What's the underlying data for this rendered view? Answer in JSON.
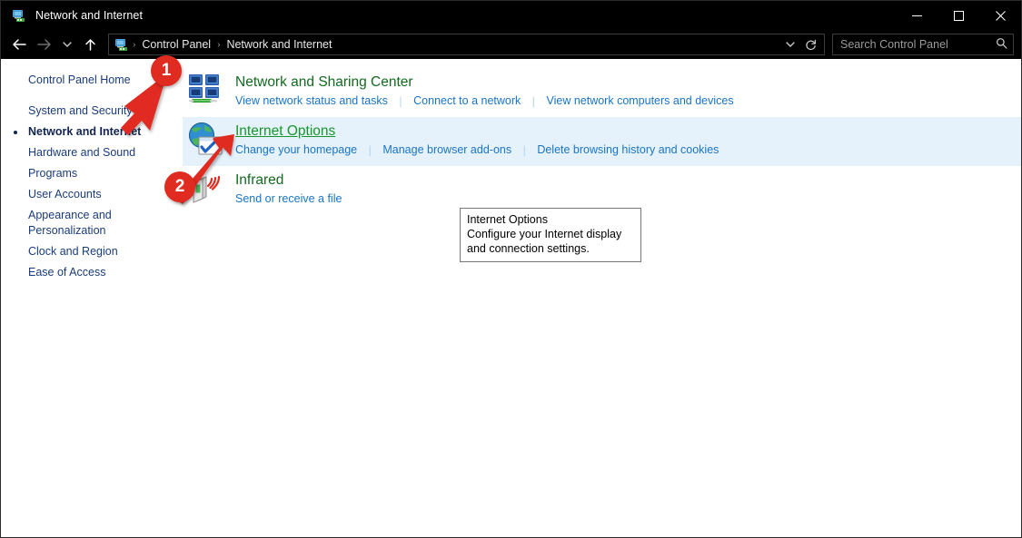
{
  "window": {
    "title": "Network and Internet",
    "icon": "network-folder-icon",
    "minimize_label": "—",
    "maximize_label": "❑",
    "close_label": "✕"
  },
  "addressbar": {
    "back_label": "←",
    "forward_label": "→",
    "recent_label": "⌄",
    "up_label": "↑",
    "path_icon": "network-folder-icon",
    "crumbs": [
      "Control Panel",
      "Network and Internet"
    ],
    "separator": "›",
    "dropdown_label": "⌄",
    "refresh_label": "↻"
  },
  "search": {
    "placeholder": "Search Control Panel",
    "value": "",
    "icon": "search-icon"
  },
  "sidebar": {
    "home": "Control Panel Home",
    "items": [
      {
        "label": "System and Security",
        "current": false
      },
      {
        "label": "Network and Internet",
        "current": true
      },
      {
        "label": "Hardware and Sound",
        "current": false
      },
      {
        "label": "Programs",
        "current": false
      },
      {
        "label": "User Accounts",
        "current": false
      },
      {
        "label": "Appearance and\nPersonalization",
        "current": false
      },
      {
        "label": "Clock and Region",
        "current": false
      },
      {
        "label": "Ease of Access",
        "current": false
      }
    ]
  },
  "main": {
    "categories": [
      {
        "title": "Network and Sharing Center",
        "icon": "network-sharing-icon",
        "hovered": false,
        "links": [
          "View network status and tasks",
          "Connect to a network",
          "View network computers and devices"
        ]
      },
      {
        "title": "Internet Options",
        "icon": "internet-options-icon",
        "hovered": true,
        "links": [
          "Change your homepage",
          "Manage browser add-ons",
          "Delete browsing history and cookies"
        ]
      },
      {
        "title": "Infrared",
        "icon": "infrared-icon",
        "hovered": false,
        "links": [
          "Send or receive a file"
        ]
      }
    ]
  },
  "tooltip": {
    "title": "Internet Options",
    "body": "Configure your Internet display and connection settings."
  },
  "annotations": [
    {
      "number": "1",
      "target": "sidebar-item-network-and-internet"
    },
    {
      "number": "2",
      "target": "internet-options-icon"
    }
  ],
  "colors": {
    "accent_green": "#13691f",
    "link_blue": "#1a74c4",
    "nav_blue": "#1a3c7a",
    "hover_row": "#e5f2fc",
    "marker_red": "#e02b20",
    "titlebar_bg": "#000000"
  }
}
